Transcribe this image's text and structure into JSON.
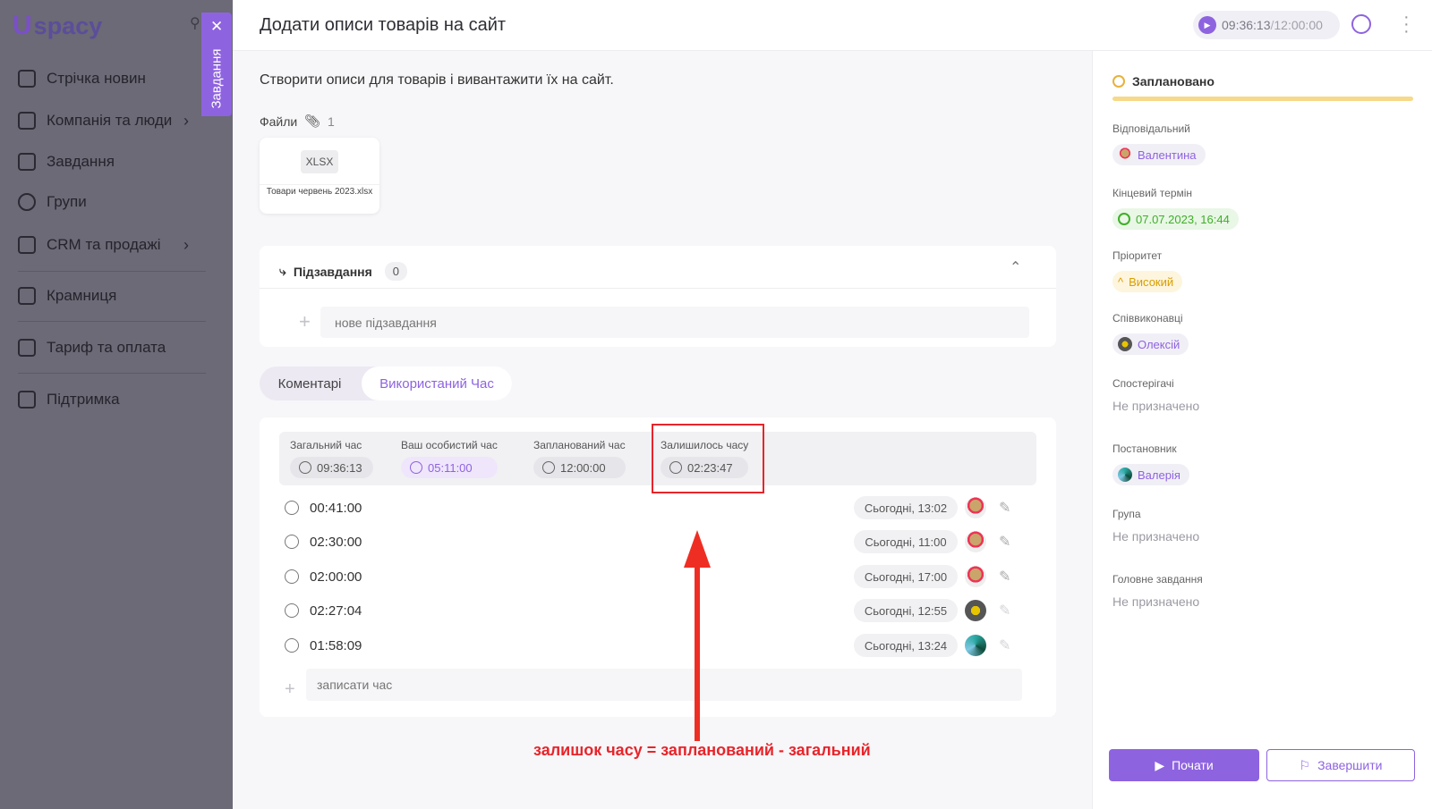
{
  "app": {
    "logo_u": "U",
    "logo_text": "spacy"
  },
  "sidebar": {
    "items": [
      {
        "label": "Стрічка новин",
        "icon": "home-icon"
      },
      {
        "label": "Компанія та люди",
        "icon": "building-icon",
        "chevron": true
      },
      {
        "label": "Завдання",
        "icon": "calendar-icon"
      },
      {
        "label": "Групи",
        "icon": "users-icon"
      },
      {
        "label": "CRM та продажі",
        "icon": "database-icon",
        "chevron": true
      },
      {
        "label": "Крамниця",
        "icon": "store-icon"
      },
      {
        "label": "Тариф та оплата",
        "icon": "wallet-icon"
      },
      {
        "label": "Підтримка",
        "icon": "help-icon"
      }
    ],
    "tasks_tab": "Завдання"
  },
  "header": {
    "title": "Додати описи товарів на сайт",
    "timer_current": "09:36:13",
    "timer_sep": "/",
    "timer_planned": "12:00:00"
  },
  "task": {
    "description": "Створити описи для товарів і вивантажити їх на сайт.",
    "files_label": "Файли",
    "files_count": "1",
    "file": {
      "type": "XLSX",
      "name": "Товари червень 2023.xlsx"
    }
  },
  "subtasks": {
    "title": "Підзавдання",
    "count": "0",
    "placeholder": "нове підзавдання"
  },
  "tabs": {
    "comments": "Коментарі",
    "time_used": "Використаний Час"
  },
  "time_summary": {
    "total": {
      "label": "Загальний час",
      "value": "09:36:13"
    },
    "personal": {
      "label": "Ваш особистий час",
      "value": "05:11:00"
    },
    "planned": {
      "label": "Запланований час",
      "value": "12:00:00"
    },
    "remaining": {
      "label": "Залишилось часу",
      "value": "02:23:47"
    }
  },
  "time_entries": [
    {
      "duration": "00:41:00",
      "when": "Сьогодні, 13:02"
    },
    {
      "duration": "02:30:00",
      "when": "Сьогодні, 11:00"
    },
    {
      "duration": "02:00:00",
      "when": "Сьогодні, 17:00"
    },
    {
      "duration": "02:27:04",
      "when": "Сьогодні, 12:55"
    },
    {
      "duration": "01:58:09",
      "when": "Сьогодні, 13:24"
    }
  ],
  "log_placeholder": "записати час",
  "annotation": "залишок часу =  запланований - загальний",
  "right": {
    "status": "Заплановано",
    "responsible": {
      "label": "Відповідальний",
      "value": "Валентина"
    },
    "deadline": {
      "label": "Кінцевий термін",
      "value": "07.07.2023, 16:44"
    },
    "priority": {
      "label": "Пріоритет",
      "value": "Високий"
    },
    "coexecutors": {
      "label": "Співвиконавці",
      "value": "Олексій"
    },
    "observers": {
      "label": "Спостерігачі",
      "value": "Не призначено"
    },
    "creator": {
      "label": "Постановник",
      "value": "Валерія"
    },
    "group": {
      "label": "Група",
      "value": "Не призначено"
    },
    "parent_task": {
      "label": "Головне завдання",
      "value": "Не призначено"
    },
    "start_button": "Почати",
    "finish_button": "Завершити"
  },
  "colors": {
    "accent": "#8e63e0",
    "annotation": "#e8242b",
    "status": "#e8b23a",
    "deadline": "#3fae2a"
  }
}
